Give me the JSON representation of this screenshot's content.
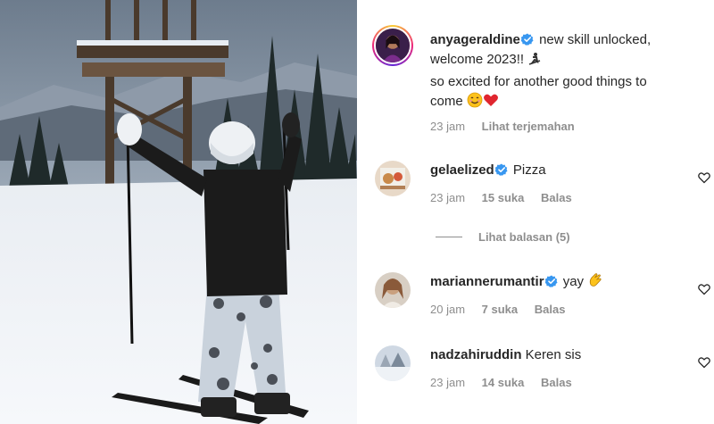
{
  "caption": {
    "username": "anyageraldine",
    "text_line1": "new skill unlocked,",
    "text_line2": "welcome 2023!!",
    "text_line3": "so excited for another good things to",
    "text_line4": "come",
    "time": "23 jam",
    "translate_label": "Lihat terjemahan"
  },
  "comments": [
    {
      "username": "gelaelized",
      "verified": true,
      "text": "Pizza",
      "time": "23 jam",
      "likes": "15 suka",
      "reply_label": "Balas"
    },
    {
      "username": "mariannerumantir",
      "verified": true,
      "text": "yay",
      "time": "20 jam",
      "likes": "7 suka",
      "reply_label": "Balas"
    },
    {
      "username": "nadzahiruddin",
      "verified": false,
      "text": "Keren sis",
      "time": "23 jam",
      "likes": "14 suka",
      "reply_label": "Balas"
    }
  ],
  "view_replies_label": "Lihat balasan (5)",
  "icons": {
    "verified": "verified-badge-icon",
    "heart": "heart-outline-icon",
    "ski": "skier-emoji-icon",
    "smile": "smiling-face-emoji-icon",
    "red_heart": "red-heart-emoji-icon",
    "clap": "clapping-hands-emoji-icon"
  },
  "colors": {
    "verified": "#3897f0",
    "meta_text": "#8e8e8e",
    "text": "#262626"
  }
}
